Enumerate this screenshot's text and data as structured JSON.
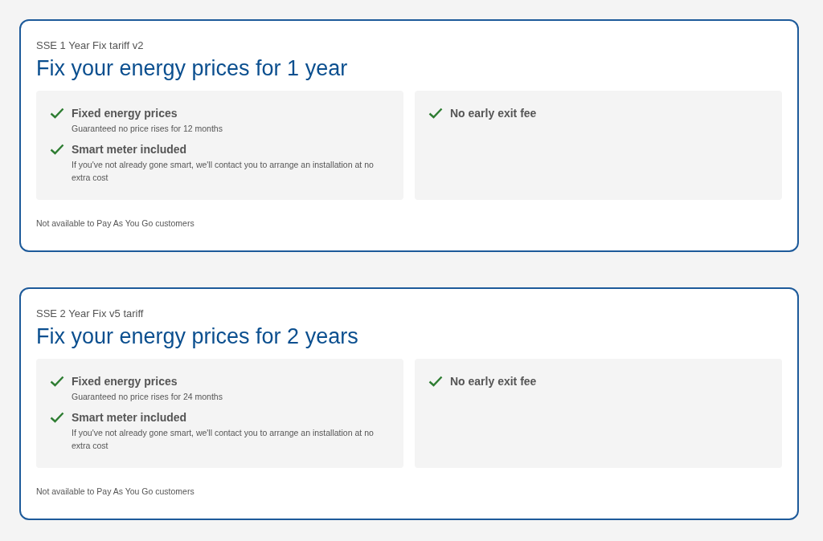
{
  "tariffs": [
    {
      "tariff_name": "SSE 1 Year Fix tariff v2",
      "heading": "Fix your energy prices for 1 year",
      "benefit_panels": [
        {
          "items": [
            {
              "title": "Fixed energy prices",
              "description": "Guaranteed no price rises for 12 months"
            },
            {
              "title": "Smart meter included",
              "description": "If you've not already gone smart, we'll contact you to arrange an installation at no extra cost"
            }
          ]
        },
        {
          "items": [
            {
              "title": "No early exit fee"
            }
          ]
        }
      ],
      "note": "Not available to Pay As You Go customers"
    },
    {
      "tariff_name": "SSE 2 Year Fix v5 tariff",
      "heading": "Fix your energy prices for 2 years",
      "benefit_panels": [
        {
          "items": [
            {
              "title": "Fixed energy prices",
              "description": "Guaranteed no price rises for 24 months"
            },
            {
              "title": "Smart meter included",
              "description": "If you've not already gone smart, we'll contact you to arrange an installation at no extra cost"
            }
          ]
        },
        {
          "items": [
            {
              "title": "No early exit fee"
            }
          ]
        }
      ],
      "note": "Not available to Pay As You Go customers"
    }
  ]
}
